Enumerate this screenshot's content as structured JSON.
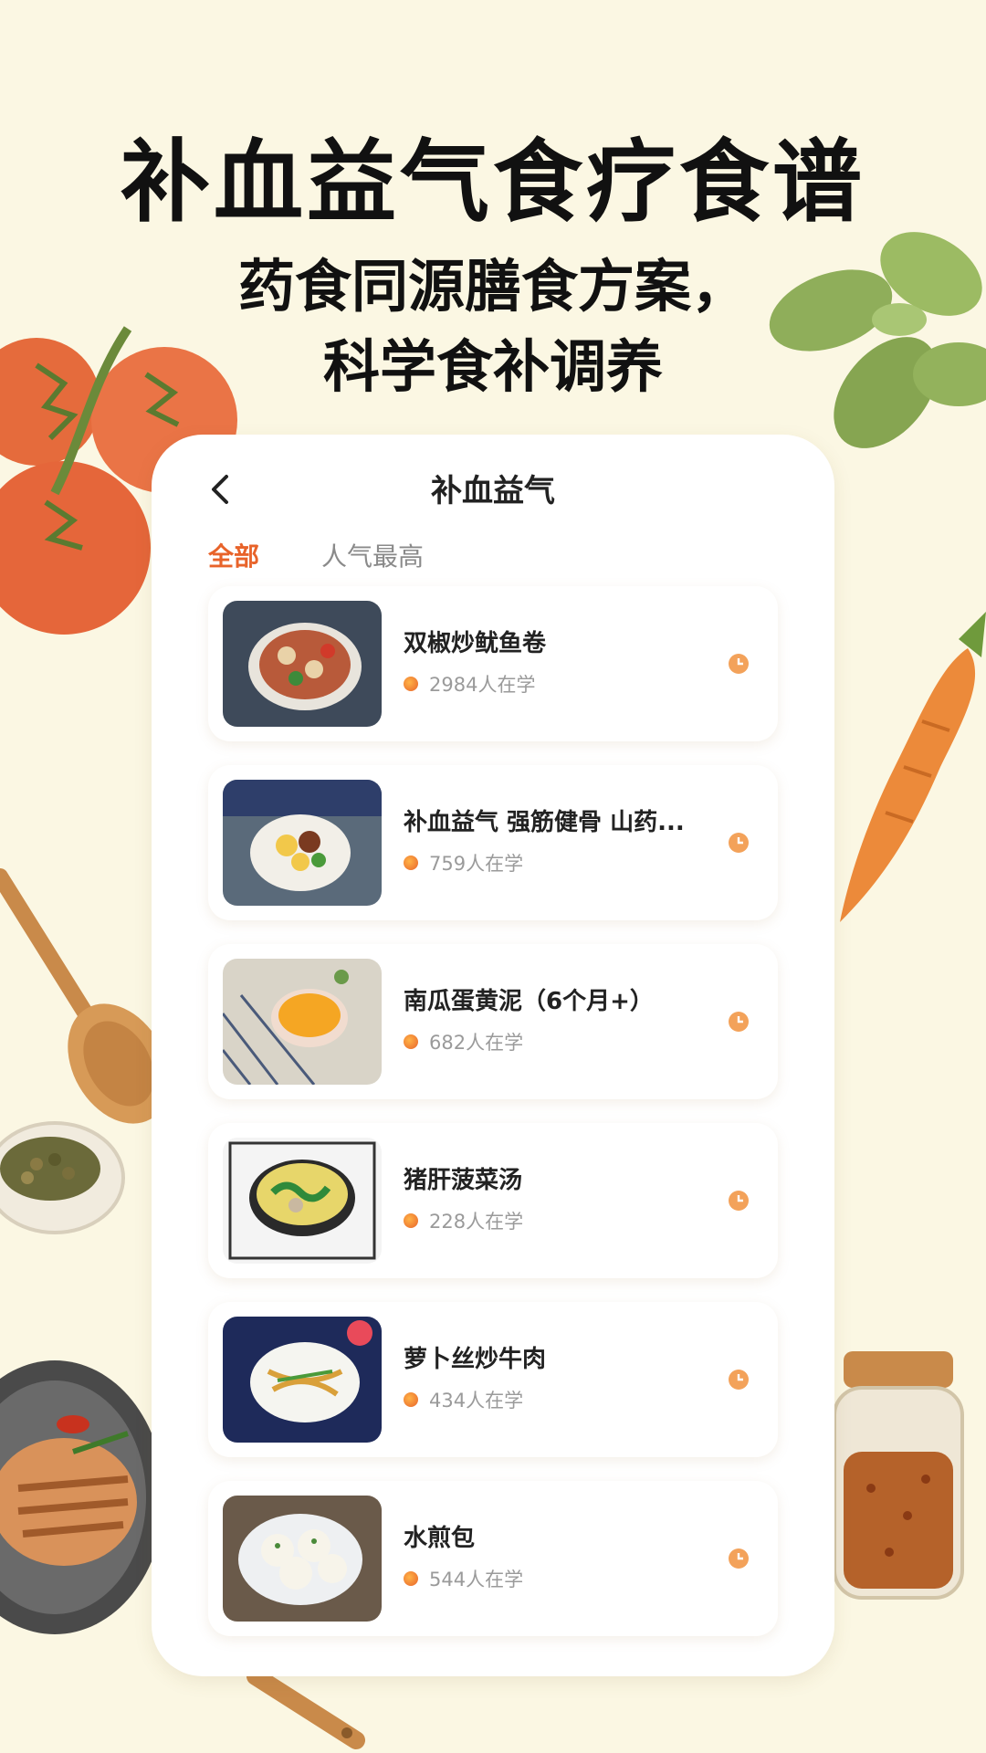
{
  "hero": {
    "title": "补血益气食疗食谱",
    "subtitle_line1": "药食同源膳食方案，",
    "subtitle_line2": "科学食补调养"
  },
  "screen": {
    "title": "补血益气",
    "back_icon": "chevron-left-icon",
    "tabs": [
      {
        "label": "全部",
        "active": true
      },
      {
        "label": "人气最高",
        "active": false
      }
    ]
  },
  "recipes": [
    {
      "title": "双椒炒鱿鱼卷",
      "learners": "2984人在学"
    },
    {
      "title": "补血益气 强筋健骨 山药...",
      "learners": "759人在学"
    },
    {
      "title": "南瓜蛋黄泥（6个月+）",
      "learners": "682人在学"
    },
    {
      "title": "猪肝菠菜汤",
      "learners": "228人在学"
    },
    {
      "title": "萝卜丝炒牛肉",
      "learners": "434人在学"
    },
    {
      "title": "水煎包",
      "learners": "544人在学"
    }
  ],
  "colors": {
    "background": "#fbf7e3",
    "accent": "#e8632a",
    "muted_text": "#9a9a9a"
  }
}
